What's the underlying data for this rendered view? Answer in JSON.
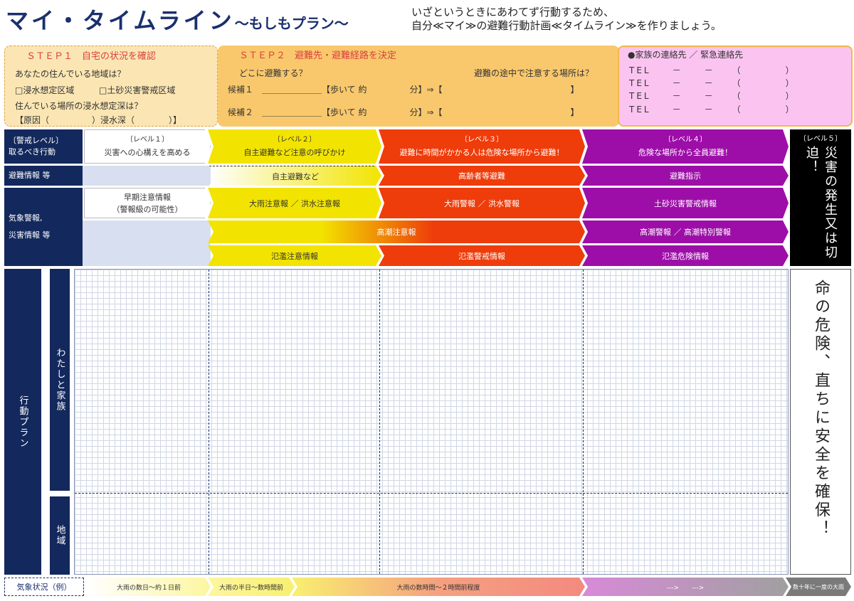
{
  "header": {
    "title": "マイ・タイムライン",
    "subtitle": "～もしもプラン～",
    "intro_line1": "いざというときにあわてず行動するため、",
    "intro_line2": "自分≪マイ≫の避難行動計画≪タイムライン≫を作りましょう。"
  },
  "step1": {
    "heading": "ＳＴＥＰ１　自宅の状況を確認",
    "q1": "あなたの住んでいる地域は？",
    "opt1": "□浸水想定区域",
    "opt2": "□土砂災害警戒区域",
    "q2": "住んでいる場所の浸水想定深は？",
    "answer": "【原因（　　　　　）浸水深（　　　　）】"
  },
  "step2": {
    "heading": "ＳＴＥＰ２　避難先・避難経路を決定",
    "q1": "どこに避難する？",
    "q2": "避難の途中で注意する場所は？",
    "cand1": "候補１　＿＿＿＿＿＿＿【歩いて 約　　　　　分】⇒【　　　　　　　　　　　　　　　】",
    "cand2": "候補２　＿＿＿＿＿＿＿【歩いて 約　　　　　分】⇒【　　　　　　　　　　　　　　　】"
  },
  "contacts": {
    "heading": "●家族の連絡先 ／ 緊急連絡先",
    "lines": [
      "TEL　　－　　－　　（　　　　）",
      "TEL　　－　　－　　（　　　　）",
      "TEL　　－　　－　　（　　　　）",
      "TEL　　－　　－　　（　　　　）"
    ]
  },
  "rows": {
    "level_header_1": "〔警戒レベル〕",
    "level_header_2": "取るべき行動",
    "evac_header": "避難情報 等",
    "warn_header_1": "気象警報,",
    "warn_header_2": "災害情報 等",
    "plan_header": "行動プラン",
    "family_header": "わたしと家族",
    "area_header": "地域"
  },
  "levels": [
    {
      "tag": "〔レベル１〕",
      "action": "災害への心構えを高める"
    },
    {
      "tag": "〔レベル２〕",
      "action": "自主避難など注意の呼びかけ"
    },
    {
      "tag": "〔レベル３〕",
      "action": "避難に時間がかかる人は危険な場所から避難！"
    },
    {
      "tag": "〔レベル４〕",
      "action": "危険な場所から全員避難！"
    },
    {
      "tag": "〔レベル５〕",
      "action": "災害の発生又は切迫！"
    }
  ],
  "evac": {
    "l2": "自主避難など",
    "l3": "高齢者等避難",
    "l4": "避難指示"
  },
  "warnings": {
    "l1_line1": "早期注意情報",
    "l1_line2": "（警報級の可能性）",
    "l2_rain": "大雨注意報 ／ 洪水注意報",
    "l3_rain": "大雨警報 ／ 洪水警報",
    "l4_sediment": "土砂災害警戒情報",
    "storm_surge_adv": "高潮注意報",
    "storm_surge_warn": "高潮警報 ／ 高潮特別警報",
    "flood_l2": "氾濫注意情報",
    "flood_l3": "氾濫警戒情報",
    "flood_l4": "氾濫危険情報"
  },
  "level5_box": "命の危険、直ちに安全を確保！",
  "weather": {
    "label": "気象状況（例）",
    "stage1": "大雨の数日～約１日前",
    "stage2": "大雨の半日～数時間前",
    "stage3": "大雨の数時間～２時間前程度",
    "stage4": "--->　　--->",
    "stage5": "数十年に一度の大雨"
  },
  "colors": {
    "navy": "#13285c",
    "yellow": "#f2e400",
    "red": "#ee3c0a",
    "purple": "#9d0ea8",
    "black": "#000000"
  }
}
